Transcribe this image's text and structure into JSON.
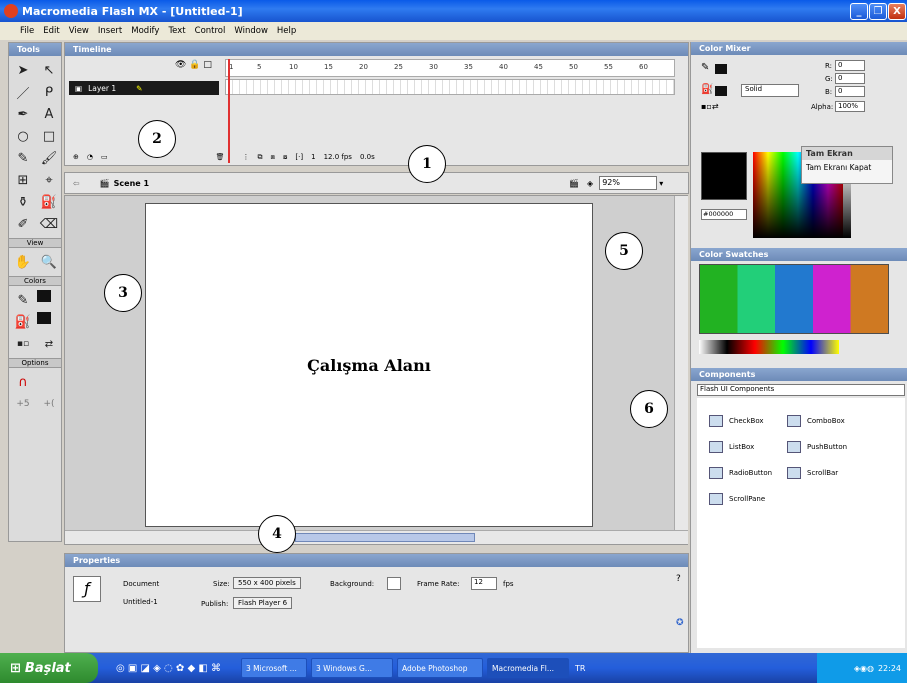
{
  "window": {
    "title": "Macromedia Flash MX - [Untitled-1]",
    "controls": [
      "_",
      "❐",
      "X"
    ]
  },
  "menu": [
    "File",
    "Edit",
    "View",
    "Insert",
    "Modify",
    "Text",
    "Control",
    "Window",
    "Help"
  ],
  "tools": {
    "title": "Tools",
    "sections": {
      "view": "View",
      "colors": "Colors",
      "options": "Options"
    }
  },
  "timeline": {
    "title": "Timeline",
    "layer": "Layer 1",
    "frame_numbers": [
      "1",
      "5",
      "10",
      "15",
      "20",
      "25",
      "30",
      "35",
      "40",
      "45",
      "50",
      "55",
      "60"
    ],
    "current_frame": "1",
    "fps": "12.0 fps",
    "time": "0.0s",
    "scene": "Scene 1",
    "zoom": "92%"
  },
  "stage": {
    "label": "Çalışma Alanı"
  },
  "properties": {
    "title": "Properties",
    "doc_type": "Document",
    "doc_name": "Untitled-1",
    "size_label": "Size:",
    "size_value": "550 x 400 pixels",
    "background_label": "Background:",
    "frame_rate_label": "Frame Rate:",
    "frame_rate_value": "12",
    "fps_unit": "fps",
    "publish_label": "Publish:",
    "publish_value": "Flash Player 6"
  },
  "color_mixer": {
    "title": "Color Mixer",
    "fill_type": "Solid",
    "r_label": "R:",
    "r": "0",
    "g_label": "G:",
    "g": "0",
    "b_label": "B:",
    "b": "0",
    "alpha_label": "Alpha:",
    "alpha": "100%",
    "hex": "#000000",
    "popup_title": "Tam Ekran",
    "popup_item": "Tam Ekranı Kapat"
  },
  "swatches": {
    "title": "Color Swatches"
  },
  "components": {
    "title": "Components",
    "set": "Flash UI Components",
    "items": [
      "CheckBox",
      "ComboBox",
      "ListBox",
      "PushButton",
      "RadioButton",
      "ScrollBar",
      "ScrollPane"
    ]
  },
  "callouts": [
    "1",
    "2",
    "3",
    "4",
    "5",
    "6"
  ],
  "taskbar": {
    "start": "Başlat",
    "items": [
      "3 Microsoft ...",
      "3 Windows G...",
      "Adobe Photoshop",
      "Macromedia Fl..."
    ],
    "lang": "TR",
    "clock": "22:24"
  },
  "colors": {
    "titlebar": "#0a5ae8",
    "panel_header": "#7b97c3",
    "playhead": "#e03030"
  }
}
